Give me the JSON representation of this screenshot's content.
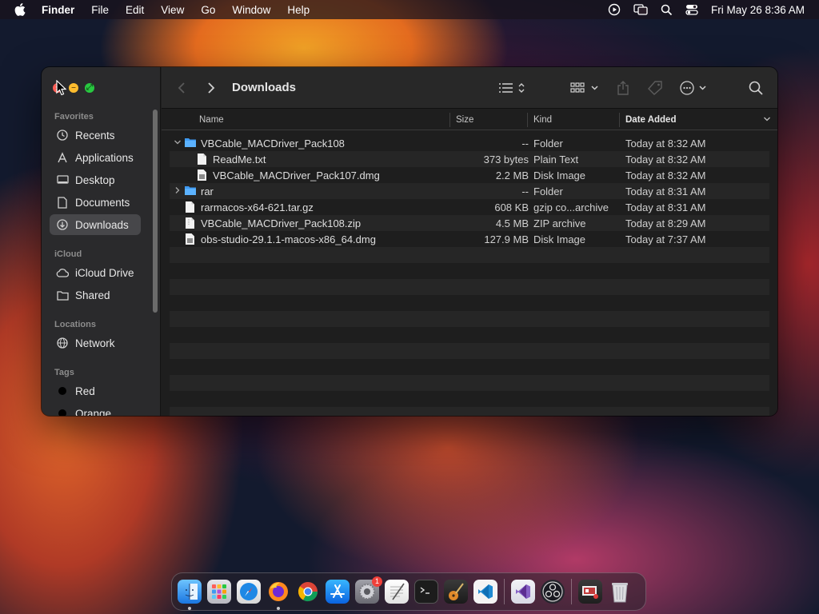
{
  "menubar": {
    "app_name": "Finder",
    "menus": [
      "File",
      "Edit",
      "View",
      "Go",
      "Window",
      "Help"
    ],
    "clock": "Fri May 26  8:36 AM",
    "status_icons": [
      "screen-record-icon",
      "screen-mirroring-icon",
      "spotlight-search-icon",
      "control-center-icon"
    ]
  },
  "window": {
    "title": "Downloads",
    "sidebar": {
      "sections": {
        "favorites": "Favorites",
        "icloud": "iCloud",
        "locations": "Locations",
        "tags": "Tags"
      },
      "favorites": [
        {
          "label": "Recents",
          "icon": "clock-icon"
        },
        {
          "label": "Applications",
          "icon": "applications-icon"
        },
        {
          "label": "Desktop",
          "icon": "desktop-icon"
        },
        {
          "label": "Documents",
          "icon": "document-icon"
        },
        {
          "label": "Downloads",
          "icon": "download-icon",
          "selected": true
        }
      ],
      "icloud": [
        {
          "label": "iCloud Drive",
          "icon": "cloud-icon"
        },
        {
          "label": "Shared",
          "icon": "shared-folder-icon"
        }
      ],
      "locations": [
        {
          "label": "Network",
          "icon": "globe-icon"
        }
      ],
      "tags": [
        {
          "label": "Red",
          "color": "#000000"
        },
        {
          "label": "Orange",
          "color": "#000000"
        }
      ]
    },
    "columns": {
      "name": "Name",
      "size": "Size",
      "kind": "Kind",
      "date_added": "Date Added"
    },
    "files": [
      {
        "name": "VBCable_MACDriver_Pack108",
        "size": "--",
        "kind": "Folder",
        "date": "Today at 8:32 AM",
        "type": "folder",
        "expanded": true
      },
      {
        "name": "ReadMe.txt",
        "size": "373 bytes",
        "kind": "Plain Text",
        "date": "Today at 8:32 AM",
        "type": "text"
      },
      {
        "name": "VBCable_MACDriver_Pack107.dmg",
        "size": "2.2 MB",
        "kind": "Disk Image",
        "date": "Today at 8:32 AM",
        "type": "dmg"
      },
      {
        "name": "rar",
        "size": "--",
        "kind": "Folder",
        "date": "Today at 8:31 AM",
        "type": "folder",
        "expanded": false
      },
      {
        "name": "rarmacos-x64-621.tar.gz",
        "size": "608 KB",
        "kind": "gzip co...archive",
        "date": "Today at 8:31 AM",
        "type": "archive"
      },
      {
        "name": "VBCable_MACDriver_Pack108.zip",
        "size": "4.5 MB",
        "kind": "ZIP archive",
        "date": "Today at 8:29 AM",
        "type": "archive"
      },
      {
        "name": "obs-studio-29.1.1-macos-x86_64.dmg",
        "size": "127.9 MB",
        "kind": "Disk Image",
        "date": "Today at 7:37 AM",
        "type": "dmg"
      }
    ]
  },
  "dock": {
    "apps": [
      "Finder",
      "Launchpad",
      "Safari",
      "Firefox",
      "Chrome",
      "App Store",
      "System Settings",
      "TextEdit",
      "Terminal",
      "GarageBand",
      "Visual Studio Code",
      "Visual Studio",
      "OBS",
      "Preview",
      "Trash"
    ],
    "settings_badge": "1"
  }
}
